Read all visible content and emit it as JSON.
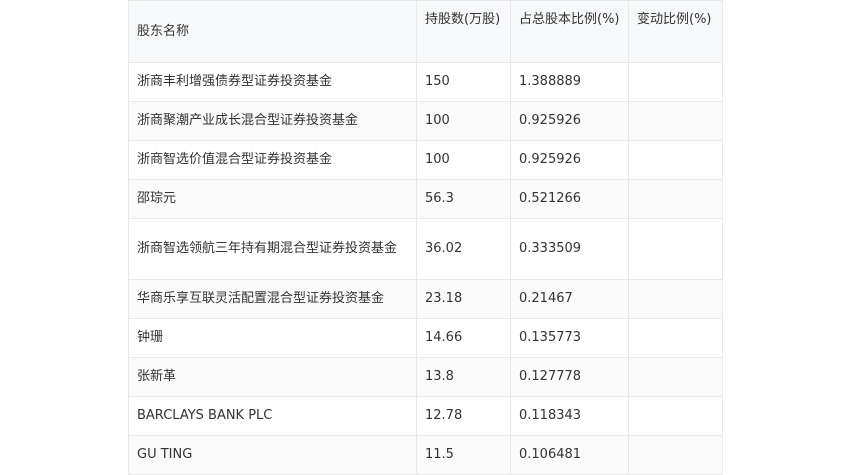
{
  "table": {
    "headers": [
      "股东名称",
      "持股数(万股)",
      "占总股本比例(%)",
      "变动比例(%)"
    ],
    "rows": [
      {
        "name": "浙商丰利增强债券型证券投资基金",
        "shares": "150",
        "ratio": "1.388889",
        "change": ""
      },
      {
        "name": "浙商聚潮产业成长混合型证券投资基金",
        "shares": "100",
        "ratio": "0.925926",
        "change": ""
      },
      {
        "name": "浙商智选价值混合型证券投资基金",
        "shares": "100",
        "ratio": "0.925926",
        "change": ""
      },
      {
        "name": "邵琮元",
        "shares": "56.3",
        "ratio": "0.521266",
        "change": ""
      },
      {
        "name": "浙商智选领航三年持有期混合型证券投资基金",
        "shares": "36.02",
        "ratio": "0.333509",
        "change": ""
      },
      {
        "name": "华商乐享互联灵活配置混合型证券投资基金",
        "shares": "23.18",
        "ratio": "0.21467",
        "change": ""
      },
      {
        "name": "钟珊",
        "shares": "14.66",
        "ratio": "0.135773",
        "change": ""
      },
      {
        "name": "张新革",
        "shares": "13.8",
        "ratio": "0.127778",
        "change": ""
      },
      {
        "name": "BARCLAYS BANK PLC",
        "shares": "12.78",
        "ratio": "0.118343",
        "change": ""
      },
      {
        "name": "GU TING",
        "shares": "11.5",
        "ratio": "0.106481",
        "change": ""
      }
    ]
  }
}
